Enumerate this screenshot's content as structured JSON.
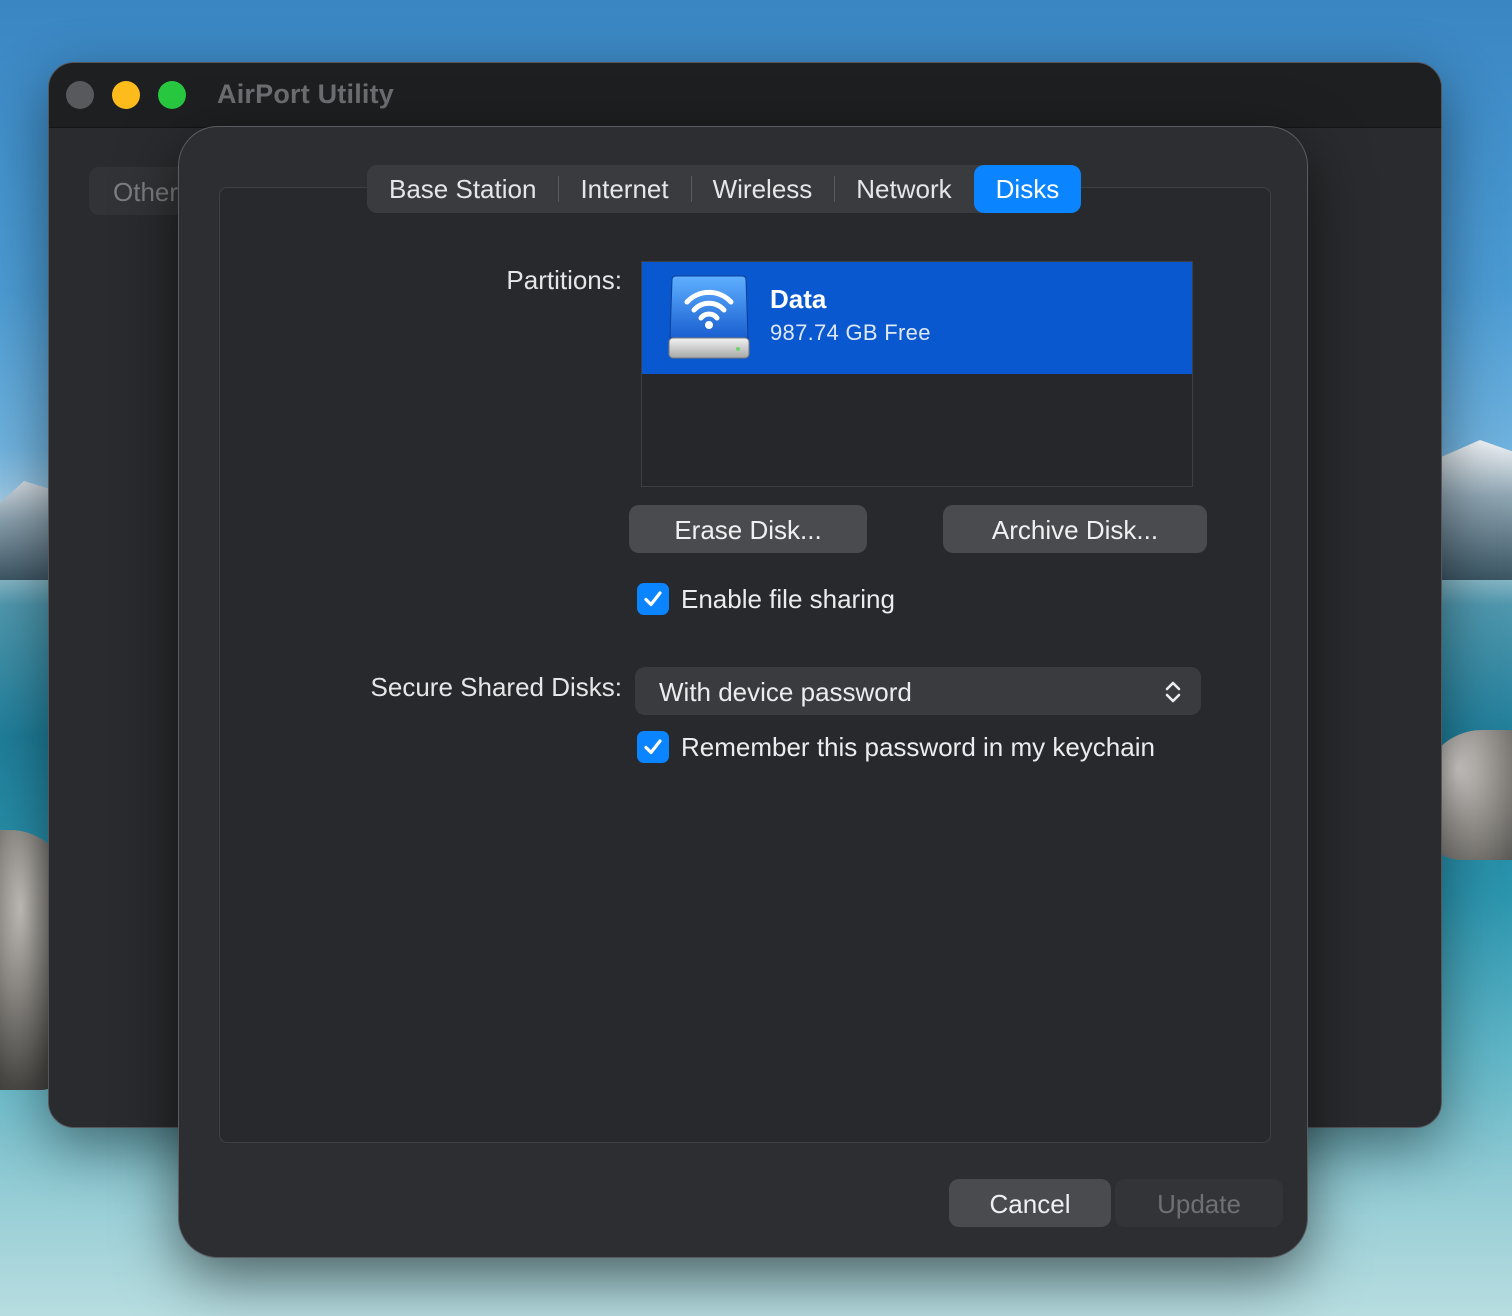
{
  "window": {
    "title": "AirPort Utility",
    "sidebar_item": "Other"
  },
  "tabs": [
    {
      "label": "Base Station"
    },
    {
      "label": "Internet"
    },
    {
      "label": "Wireless"
    },
    {
      "label": "Network"
    },
    {
      "label": "Disks",
      "active": true
    }
  ],
  "disks": {
    "partitions_label": "Partitions:",
    "partitions": [
      {
        "name": "Data",
        "free": "987.74 GB Free",
        "icon": "airport-disk-icon"
      }
    ],
    "erase_label": "Erase Disk...",
    "archive_label": "Archive Disk...",
    "file_sharing": {
      "label": "Enable file sharing",
      "checked": true
    },
    "secure_label": "Secure Shared Disks:",
    "secure_value": "With device password",
    "keychain": {
      "label": "Remember this password in my keychain",
      "checked": true
    }
  },
  "footer": {
    "cancel_label": "Cancel",
    "update_label": "Update"
  },
  "colors": {
    "accent": "#0a84ff",
    "selection": "#0a58cf",
    "sheet_bg": "#2c2e31"
  }
}
